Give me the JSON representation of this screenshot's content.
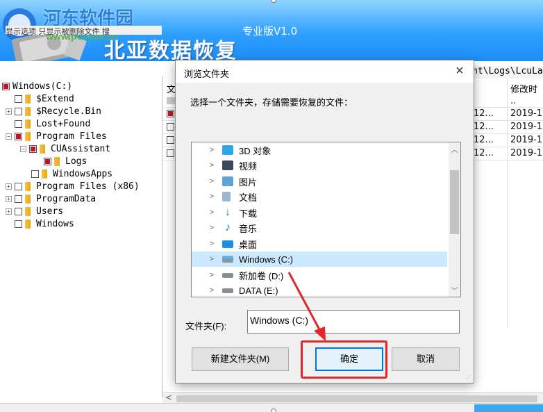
{
  "watermark": {
    "site_name": "河东软件园",
    "site_url": "www.pc0359.cn"
  },
  "app": {
    "title": "北亚数据恢复",
    "edition": "专业版V1.0"
  },
  "left_panel": {
    "header_fragment": "显示选项  只显示被删除文件  搜",
    "tree": [
      {
        "label": "Windows(C:)",
        "checked": true
      },
      {
        "label": "$Extend",
        "checked": false
      },
      {
        "label": "$Recycle.Bin",
        "checked": false
      },
      {
        "label": "Lost+Found",
        "checked": false
      },
      {
        "label": "Program Files",
        "checked": true
      },
      {
        "label": "CUAssistant",
        "checked": true
      },
      {
        "label": "Logs",
        "checked": true
      },
      {
        "label": "WindowsApps",
        "checked": false
      },
      {
        "label": "Program Files (x86)",
        "checked": false
      },
      {
        "label": "ProgramData",
        "checked": false
      },
      {
        "label": "Users",
        "checked": false
      },
      {
        "label": "Windows",
        "checked": false
      }
    ]
  },
  "file_list": {
    "path_fragment": "nt\\Logs\\LcuLa",
    "col_name_fragment": "文",
    "col_mtime": "修改时",
    "parent_dots": "..",
    "rows": [
      {
        "size": "12...",
        "mtime": "2019-1"
      },
      {
        "size": "12...",
        "mtime": "2019-1"
      },
      {
        "size": "12...",
        "mtime": "2019-1"
      },
      {
        "size": "12...",
        "mtime": "2019-1"
      }
    ]
  },
  "dialog": {
    "title": "浏览文件夹",
    "instruction": "选择一个文件夹，存储需要恢复的文件：",
    "folders": [
      {
        "label": "3D 对象",
        "icon": "3d-objects-icon",
        "color": "#2fa6e8"
      },
      {
        "label": "视频",
        "icon": "video-icon",
        "color": "#3a4a5c"
      },
      {
        "label": "图片",
        "icon": "pictures-icon",
        "color": "#5fa3d8"
      },
      {
        "label": "文档",
        "icon": "documents-icon",
        "color": "#9ab7cf"
      },
      {
        "label": "下载",
        "icon": "download-icon",
        "color": "#1f78d1"
      },
      {
        "label": "音乐",
        "icon": "music-icon",
        "color": "#1f78d1"
      },
      {
        "label": "桌面",
        "icon": "desktop-icon",
        "color": "#1e90e0"
      },
      {
        "label": "Windows (C:)",
        "icon": "drive-c-icon",
        "color": "#6c7a86",
        "selected": true
      },
      {
        "label": "新加卷 (D:)",
        "icon": "drive-icon",
        "color": "#8a8f94"
      },
      {
        "label": "DATA (E:)",
        "icon": "drive-icon",
        "color": "#8a8f94"
      }
    ],
    "folder_label": "文件夹(F):",
    "folder_value": "Windows (C:)",
    "new_folder_label": "新建文件夹(M)",
    "ok_label": "确定",
    "cancel_label": "取消"
  },
  "colors": {
    "header_blue": "#2f9fff",
    "accent_red": "#e4262a",
    "selection": "#cce8ff",
    "focus_blue": "#0078d7"
  }
}
